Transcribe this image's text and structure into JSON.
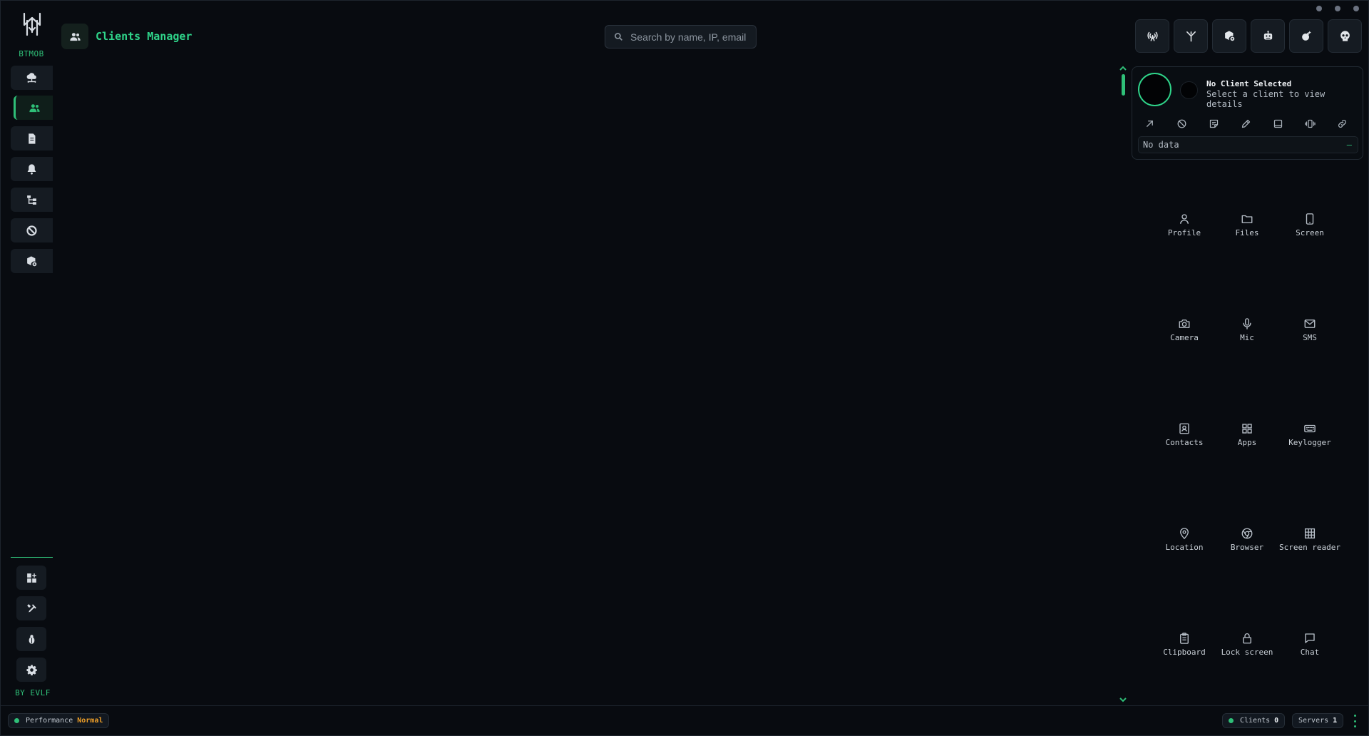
{
  "sidebar": {
    "brand": "BTMOB",
    "credit": "BY EVLF",
    "nav": [
      {
        "icon": "cloud-network-icon",
        "active": false
      },
      {
        "icon": "users-icon",
        "active": true
      },
      {
        "icon": "document-icon",
        "active": false
      },
      {
        "icon": "bell-icon",
        "active": false
      },
      {
        "icon": "sitemap-icon",
        "active": false
      },
      {
        "icon": "ban-icon",
        "active": false
      },
      {
        "icon": "cube-settings-icon",
        "active": false
      }
    ],
    "bottom": [
      {
        "icon": "grid-plus-icon"
      },
      {
        "icon": "tools-icon"
      },
      {
        "icon": "bug-icon"
      },
      {
        "icon": "gear-icon"
      }
    ]
  },
  "header": {
    "title": "Clients Manager",
    "search_placeholder": "Search by name, IP, email"
  },
  "toolbar": [
    {
      "icon": "broadcast-icon"
    },
    {
      "icon": "antenna-icon"
    },
    {
      "icon": "cube-gear-icon"
    },
    {
      "icon": "robot-icon"
    },
    {
      "icon": "bomb-icon"
    },
    {
      "icon": "skull-icon"
    }
  ],
  "client": {
    "title": "No Client Selected",
    "subtitle": "Select a client to view details",
    "info_text": "No data",
    "info_dash": "—",
    "quick_actions": [
      {
        "icon": "external-arrow-icon"
      },
      {
        "icon": "block-icon"
      },
      {
        "icon": "note-icon"
      },
      {
        "icon": "pencil-icon"
      },
      {
        "icon": "tablet-icon"
      },
      {
        "icon": "vibrate-icon"
      },
      {
        "icon": "link-icon"
      }
    ]
  },
  "features": [
    {
      "label": "Profile",
      "icon": "user-icon"
    },
    {
      "label": "Files",
      "icon": "folder-icon"
    },
    {
      "label": "Screen",
      "icon": "phone-icon"
    },
    {
      "label": "Camera",
      "icon": "camera-icon"
    },
    {
      "label": "Mic",
      "icon": "microphone-icon"
    },
    {
      "label": "SMS",
      "icon": "envelope-icon"
    },
    {
      "label": "Contacts",
      "icon": "contact-book-icon"
    },
    {
      "label": "Apps",
      "icon": "apps-grid-icon"
    },
    {
      "label": "Keylogger",
      "icon": "keyboard-icon"
    },
    {
      "label": "Location",
      "icon": "map-pin-icon"
    },
    {
      "label": "Browser",
      "icon": "chrome-icon"
    },
    {
      "label": "Screen reader",
      "icon": "table-icon"
    },
    {
      "label": "Clipboard",
      "icon": "clipboard-icon"
    },
    {
      "label": "Lock screen",
      "icon": "lock-icon"
    },
    {
      "label": "Chat",
      "icon": "chat-icon"
    }
  ],
  "footer": {
    "performance_label": "Performance",
    "performance_value": "Normal",
    "clients_label": "Clients",
    "clients_count": "0",
    "servers_label": "Servers",
    "servers_count": "1"
  },
  "colors": {
    "accent": "#2fbf78",
    "background": "#080b10",
    "warning": "#f0a028"
  }
}
